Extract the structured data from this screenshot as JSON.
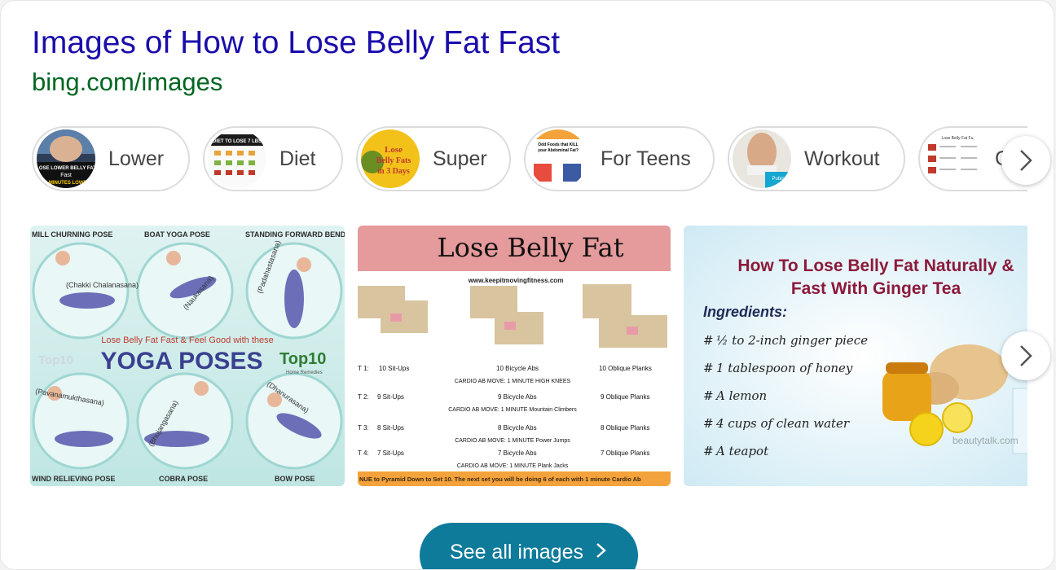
{
  "header": {
    "title": "Images of How to Lose Belly Fat Fast",
    "source": "bing.com/images"
  },
  "chips": [
    {
      "label": "Lower",
      "thumb_text": "LOSE LOWER BELLY FAT Fast 15-MINUTES LOWER"
    },
    {
      "label": "Diet",
      "thumb_text": "DIET TO LOSE 7 LBS"
    },
    {
      "label": "Super",
      "thumb_text": "Lose Belly Fats in 3 Days"
    },
    {
      "label": "For Teens",
      "thumb_text": "Odd Foods that KILL your Abdominal Fat?"
    },
    {
      "label": "Workout",
      "thumb_text": "Pubic"
    },
    {
      "label": "G",
      "thumb_text": "Lose Belly Fat Fa..."
    }
  ],
  "tiles": {
    "yoga": {
      "labels": [
        "MILL CHURNING POSE",
        "BOAT YOGA POSE",
        "STANDING FORWARD BEND",
        "(Chakki Chalanasana)",
        "(Naukasana)",
        "(Padahastasana)",
        "Lose Belly Fat Fast & Feel Good with these",
        "YOGA POSES",
        "Top10",
        "Home Remedies",
        "Top10",
        "(Pavanamukthasana)",
        "(Bhujangasana)",
        "(Dhanurasana)",
        "WIND RELIEVING POSE",
        "COBRA POSE",
        "BOW POSE"
      ]
    },
    "workout": {
      "title": "Lose Belly Fat",
      "url": "www.keepitmovingfitness.com",
      "rows": [
        {
          "set": "T 1:",
          "a": "10 Sit-Ups",
          "b": "10 Bicycle Abs",
          "c": "10 Oblique Planks",
          "cardio": "CARDIO AB MOVE: 1 MINUTE  HIGH KNEES"
        },
        {
          "set": "T 2:",
          "a": "9 Sit-Ups",
          "b": "9 Bicycle Abs",
          "c": "9 Oblique Planks",
          "cardio": "CARDIO AB MOVE: 1 MINUTE  Mountain Climbers"
        },
        {
          "set": "T 3:",
          "a": "8 Sit-Ups",
          "b": "8 Bicycle Abs",
          "c": "8 Oblique Planks",
          "cardio": "CARDIO AB MOVE: 1 MINUTE  Power Jumps"
        },
        {
          "set": "T 4:",
          "a": "7 Sit-Ups",
          "b": "7 Bicycle Abs",
          "c": "7 Oblique Planks",
          "cardio": "CARDIO AB MOVE: 1 MINUTE  Plank Jacks"
        }
      ],
      "footer": "NUE to Pyramid Down to Set 10. The next set you will be doing 6 of each with 1 minute Cardio Ab"
    },
    "ginger": {
      "title_line1": "How To Lose Belly Fat Naturally &",
      "title_line2": "Fast With Ginger Tea",
      "ingredients_label": "Ingredients:",
      "items": [
        "½ to 2-inch ginger piece",
        "1 tablespoon of honey",
        "A lemon",
        "4 cups of clean water",
        "A teapot"
      ],
      "watermark": "beautytalk.com"
    }
  },
  "see_all": {
    "label": "See all images"
  },
  "colors": {
    "title": "#1a0dab",
    "source": "#006621",
    "button": "#0e7b9b"
  }
}
